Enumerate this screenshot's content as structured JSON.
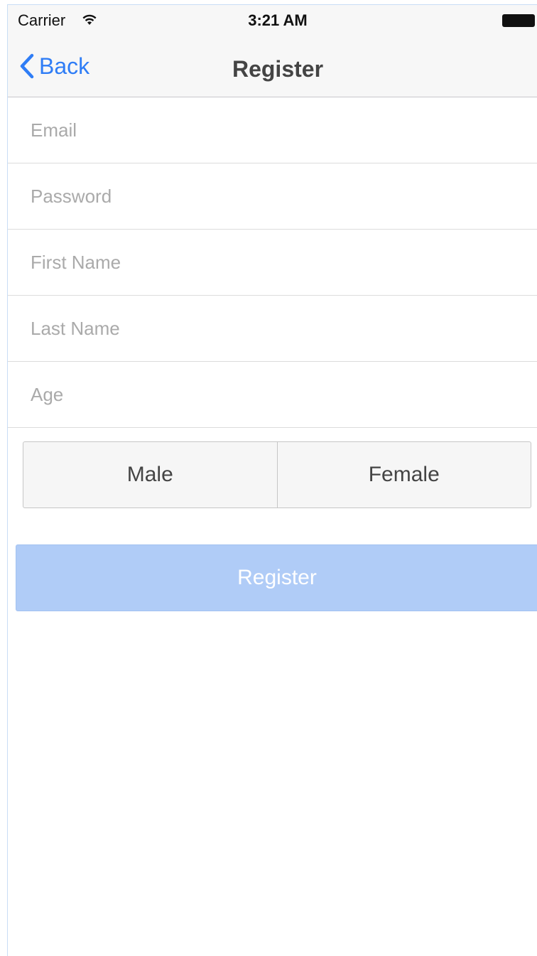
{
  "status_bar": {
    "carrier": "Carrier",
    "time": "3:21 AM",
    "wifi_icon": "wifi-icon",
    "battery_icon": "battery-icon"
  },
  "nav_bar": {
    "back_label": "Back",
    "back_icon": "chevron-left-icon",
    "title": "Register"
  },
  "form": {
    "email_placeholder": "Email",
    "email_value": "",
    "password_placeholder": "Password",
    "password_value": "",
    "first_name_placeholder": "First Name",
    "first_name_value": "",
    "last_name_placeholder": "Last Name",
    "last_name_value": "",
    "age_placeholder": "Age",
    "age_value": ""
  },
  "gender": {
    "options": [
      "Male",
      "Female"
    ]
  },
  "register_button": {
    "label": "Register"
  },
  "colors": {
    "accent": "#2f7df6",
    "register_button_bg": "#b0ccf7",
    "nav_bg": "#f7f7f7",
    "placeholder": "#aaaaaa"
  }
}
